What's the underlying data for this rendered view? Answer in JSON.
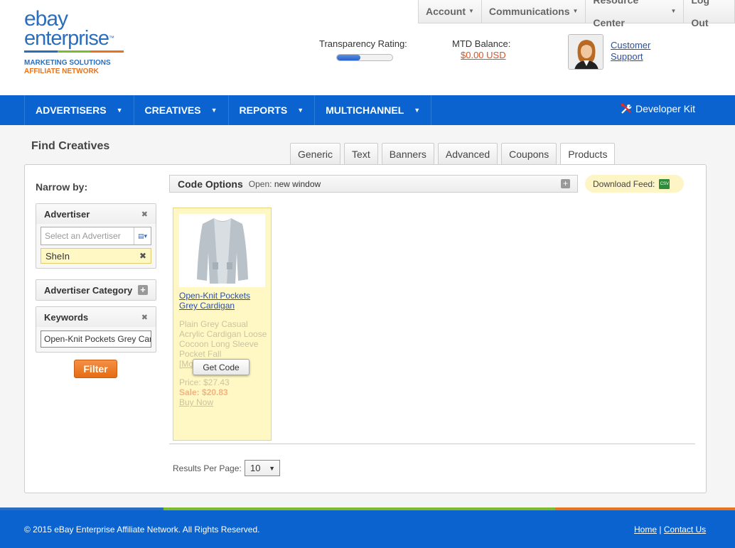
{
  "brand": {
    "line1": "ebay",
    "line2": "enterprise",
    "tm": "™",
    "sub1": "MARKETING SOLUTIONS",
    "sub2": "AFFILIATE NETWORK",
    "colors": [
      "#2a6ebd",
      "#7dba2f",
      "#e8731b"
    ]
  },
  "topnav": [
    {
      "label": "Account",
      "has_caret": true
    },
    {
      "label": "Communications",
      "has_caret": true
    },
    {
      "label": "Resource Center",
      "has_caret": true
    },
    {
      "label": "Log Out",
      "has_caret": false
    }
  ],
  "header": {
    "transparency_label": "Transparency Rating:",
    "transparency_fill_pct": 42,
    "mtd_label": "MTD Balance:",
    "mtd_value": "$0.00 USD",
    "support_line1": "Customer",
    "support_line2": "Support"
  },
  "mainnav": {
    "items": [
      "ADVERTISERS",
      "CREATIVES",
      "REPORTS",
      "MULTICHANNEL"
    ],
    "devkit": "Developer Kit"
  },
  "page": {
    "title": "Find Creatives",
    "tabs": [
      "Generic",
      "Text",
      "Banners",
      "Advanced",
      "Coupons",
      "Products"
    ],
    "active_tab": "Products"
  },
  "filters": {
    "narrow_label": "Narrow by:",
    "advertiser_title": "Advertiser",
    "advertiser_placeholder": "Select an Advertiser",
    "advertiser_selected": "SheIn",
    "category_title": "Advertiser Category",
    "keywords_title": "Keywords",
    "keywords_value": "Open-Knit Pockets Grey Cardigan",
    "filter_button": "Filter"
  },
  "code_options": {
    "title": "Code Options",
    "open_label": "Open:",
    "open_value": "new window",
    "download_label": "Download Feed:",
    "csv_label": "CSV"
  },
  "product": {
    "title": "Open-Knit Pockets Grey Cardigan",
    "desc": "Plain Grey Casual Acrylic Cardigan Loose Cocoon Long Sleeve Pocket Fall",
    "more": "[Mo",
    "get_code": "Get Code",
    "price": "Price: $27.43",
    "sale": "Sale: $20.83",
    "buy_now": "Buy Now"
  },
  "pagination": {
    "label": "Results Per Page:",
    "value": "10"
  },
  "footer": {
    "copyright": "© 2015 eBay Enterprise Affiliate Network. All Rights Reserved.",
    "home": "Home",
    "sep": "|",
    "contact": "Contact Us"
  }
}
